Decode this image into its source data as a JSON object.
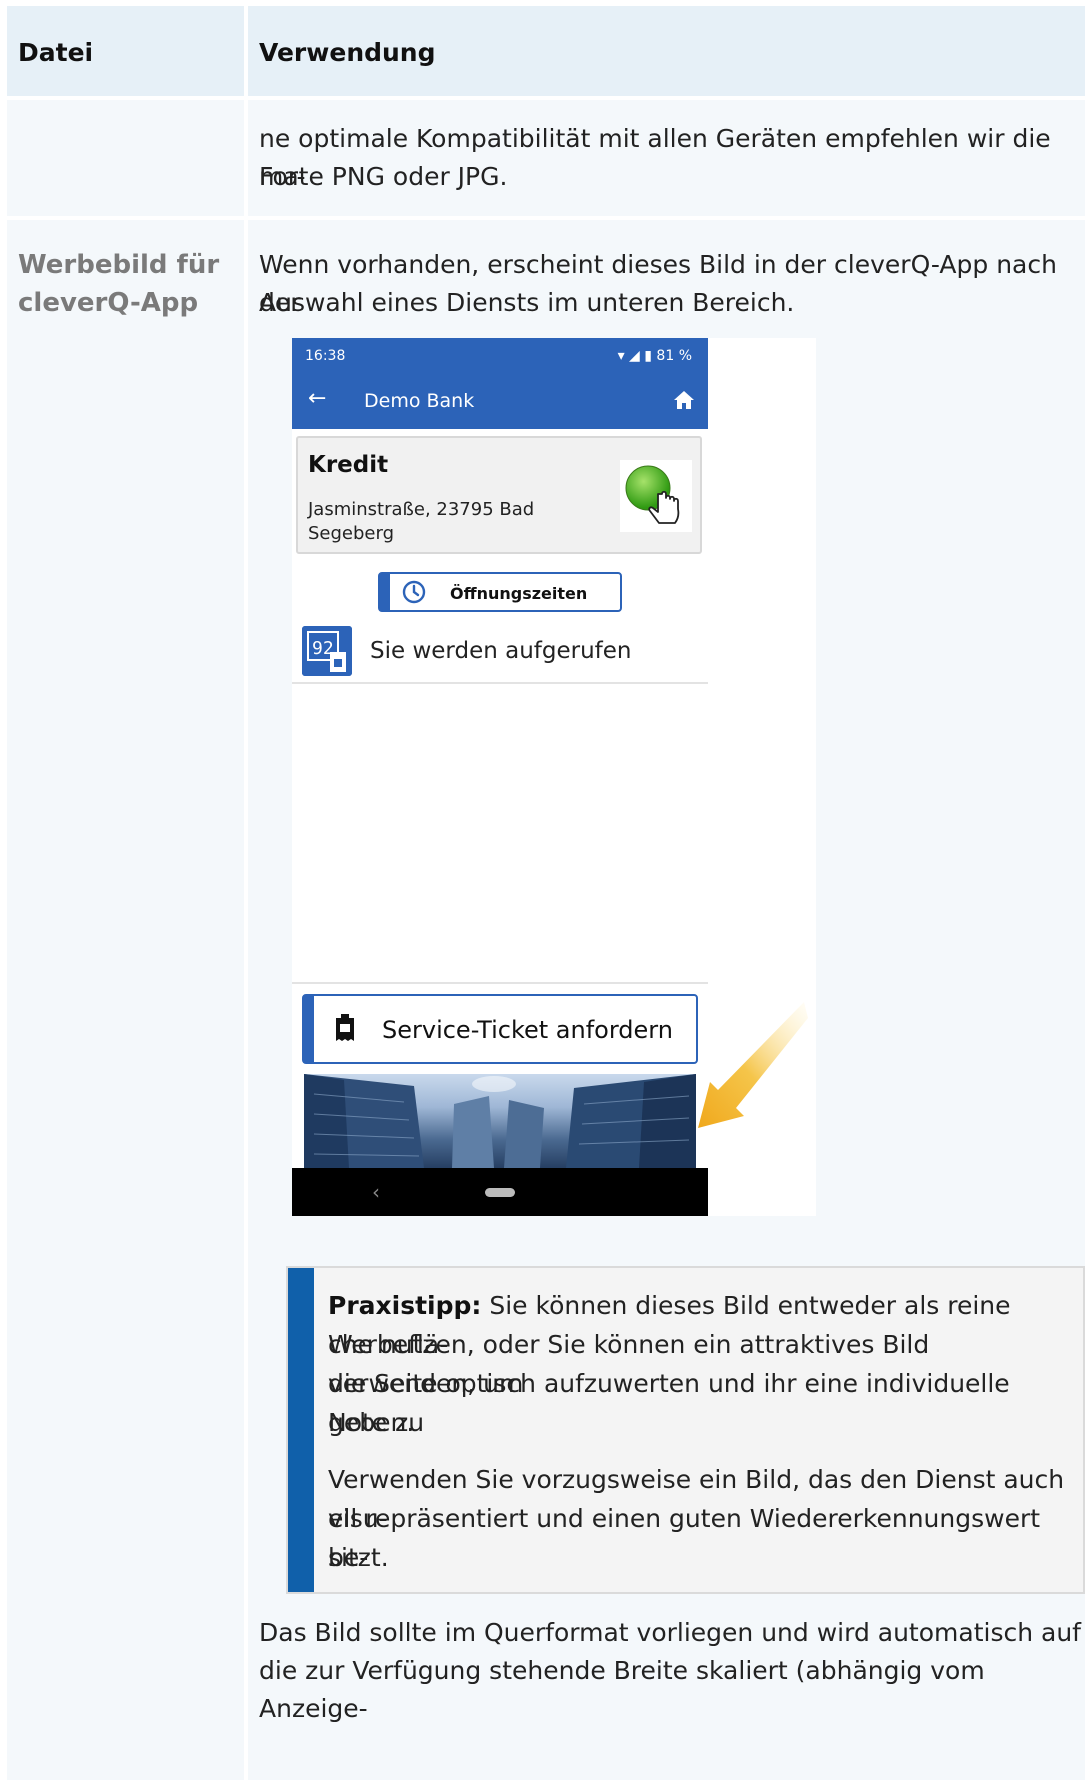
{
  "table": {
    "headers": {
      "file": "Datei",
      "usage": "Verwendung"
    },
    "row1": {
      "usage_line1": "ne optimale Kompatibilität mit allen Geräten empfehlen wir die For-",
      "usage_line2": "mate PNG oder JPG."
    },
    "row2": {
      "file_line1": "Werbebild für",
      "file_line2": "cleverQ-App",
      "intro_line1": "Wenn vorhanden, erscheint dieses Bild in der cleverQ-App nach der",
      "intro_line2": "Auswahl eines Diensts im unteren Bereich.",
      "tip": {
        "label": "Praxistipp:",
        "p1_line1": " Sie können dieses Bild entweder als reine Werbeflä-",
        "p1_line2": "che nutzen, oder Sie können ein attraktives Bild verwenden, um",
        "p1_line3": "die Seite optisch aufzuwerten und ihr eine individuelle Note zu",
        "p1_line4": "geben.",
        "p2_line1": "Verwenden Sie vorzugsweise ein Bild, das den Dienst auch visu-",
        "p2_line2": "ell repräsentiert und einen guten Wiedererkennungswert be-",
        "p2_line3": "sitzt."
      },
      "outro_line1": "Das Bild sollte im Querformat vorliegen und wird automatisch auf",
      "outro_line2": "die zur Verfügung stehende Breite skaliert (abhängig vom Anzeige-"
    }
  },
  "phone": {
    "time": "16:38",
    "status_icons": "▾ ◢ ▮ 81 %",
    "app_title": "Demo Bank",
    "card_title": "Kredit",
    "card_address": "Jasminstraße, 23795 Bad Segeberg",
    "hours_button": "Öffnungszeiten",
    "call_label": "Sie werden aufgerufen",
    "ticket_button": "Service-Ticket anfordern",
    "colors": {
      "primary": "#2c63b8",
      "tip_bar": "#1060aa",
      "arrow": "#f3b32a"
    }
  }
}
